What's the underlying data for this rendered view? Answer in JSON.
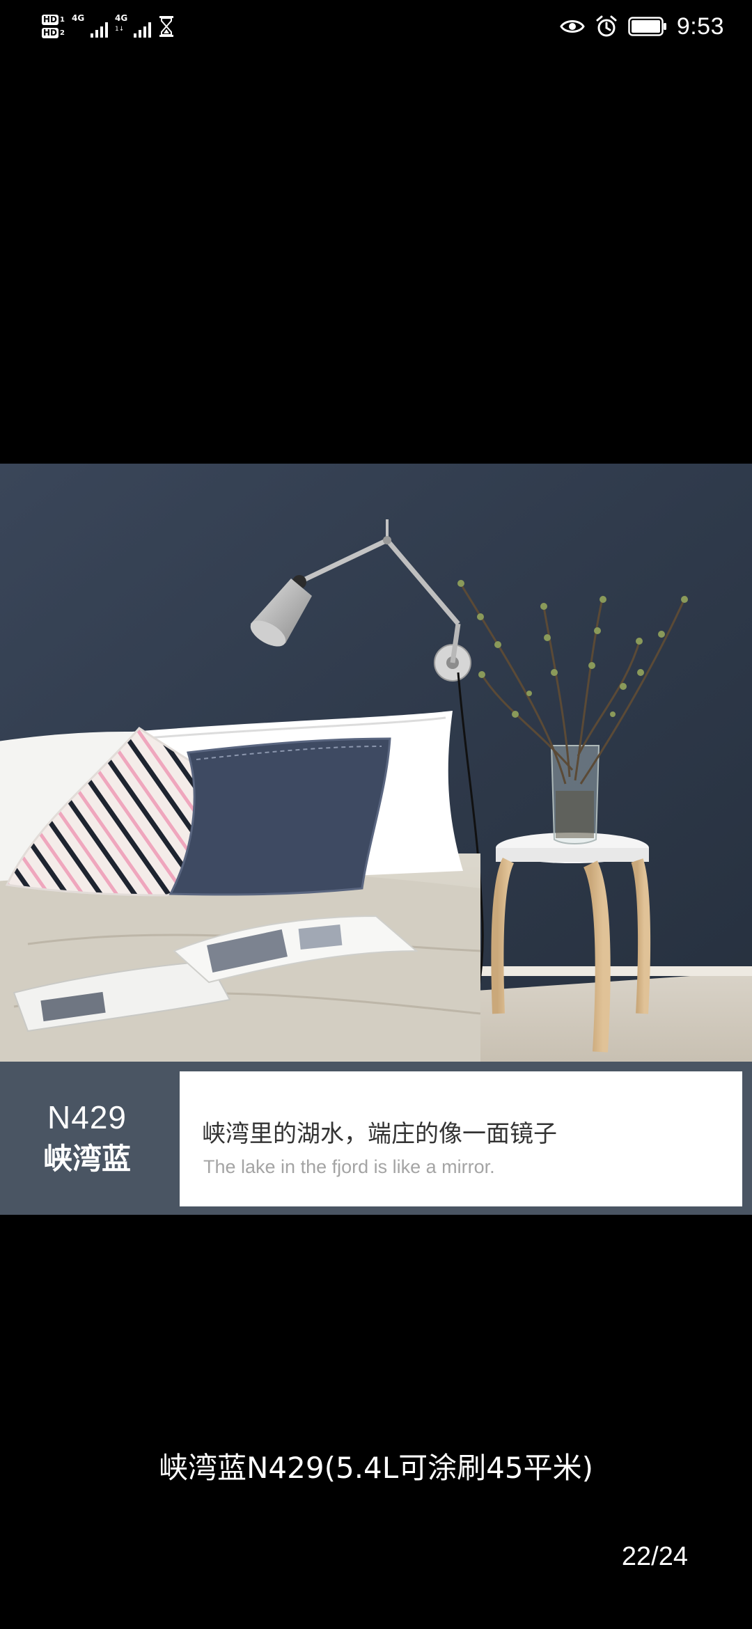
{
  "status_bar": {
    "hd1_label": "HD",
    "hd1_num": "1",
    "hd2_label": "HD",
    "hd2_num": "2",
    "net1_type": "4G",
    "net2_type": "4G",
    "net2_sub": "1↓",
    "time": "9:53",
    "icons": [
      "hd-icon",
      "signal-icon",
      "hourglass-icon",
      "eye-icon",
      "alarm-icon",
      "battery-icon"
    ]
  },
  "photo": {
    "description_icon": "bedroom-photo"
  },
  "caption_card": {
    "code": "N429",
    "name": "峡湾蓝",
    "headline_cn": "峡湾里的湖水，端庄的像一面镜子",
    "headline_en": "The lake in the fjord is like a mirror."
  },
  "product_caption": "峡湾蓝N429(5.4L可涂刷45平米)",
  "page_counter": "22/24",
  "colors": {
    "background": "#000000",
    "band": "#4a5563",
    "wall": "#2f3a4a",
    "text_primary": "#ffffff",
    "text_muted": "#a4a4a4"
  }
}
